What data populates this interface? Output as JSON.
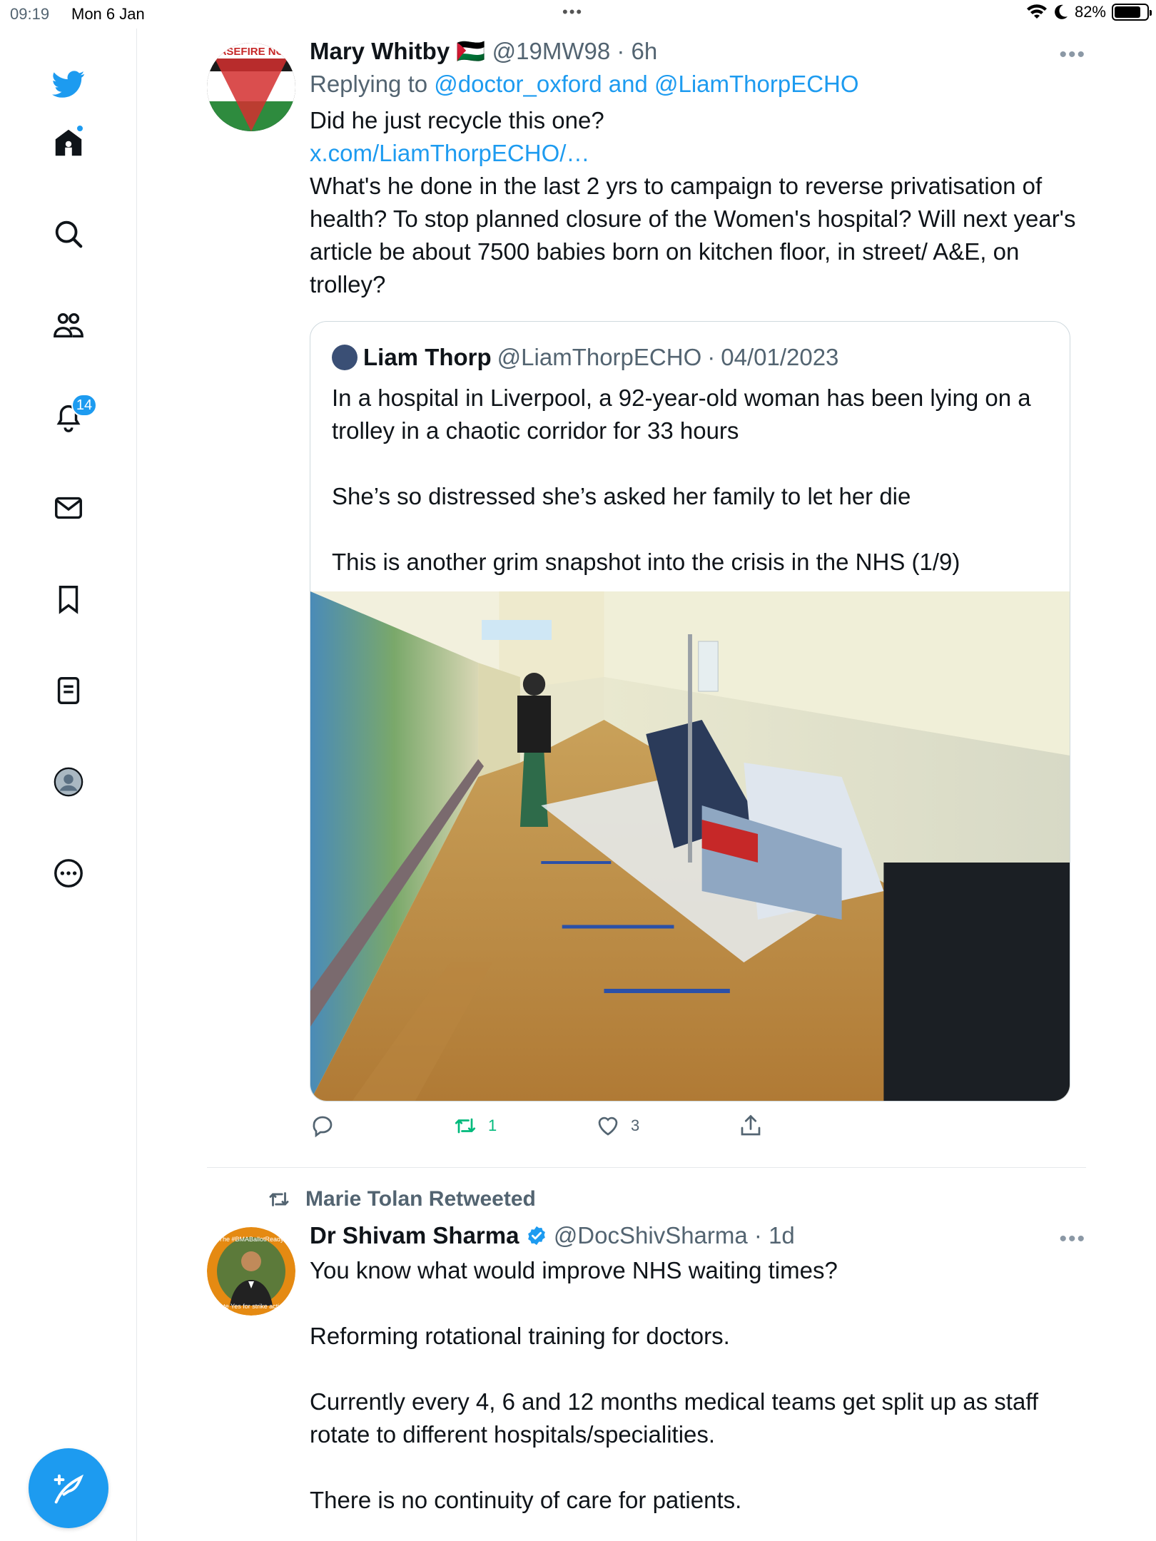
{
  "status_bar": {
    "time": "09:19",
    "date": "Mon 6 Jan",
    "battery": "82%",
    "battery_level": 0.82
  },
  "nav": {
    "notifications_badge": "14",
    "icons": [
      "twitter-logo-icon",
      "home-icon",
      "search-icon",
      "communities-icon",
      "notifications-icon",
      "messages-icon",
      "bookmarks-icon",
      "lists-icon",
      "profile-icon",
      "more-icon"
    ],
    "brand_color": "#1d9bf0"
  },
  "tweet1": {
    "avatar_text": "ASEFIRE NC",
    "name": "Mary Whitby",
    "flag": "🇵🇸",
    "handle": "@19MW98",
    "time": "6h",
    "reply_prefix": "Replying to ",
    "reply_user1": "@doctor_oxford",
    "reply_and": " and ",
    "reply_user2": "@LiamThorpECHO",
    "text_line1": "Did he just recycle this one?",
    "link": "x.com/LiamThorpECHO/…",
    "text_rest": "What's he done in the last 2 yrs to campaign to reverse privatisation of health? To stop planned closure of the Women's hospital? Will next year's article be about 7500 babies born on kitchen floor, in street/ A&E, on trolley?",
    "quote": {
      "name": "Liam Thorp",
      "handle": "@LiamThorpECHO",
      "date": "04/01/2023",
      "text": "In a hospital in Liverpool, a 92-year-old woman has been lying on a trolley in a chaotic corridor for 33 hours\n\nShe’s so distressed she’s asked her family to let her die\n\nThis is another grim snapshot into the crisis in the NHS (1/9)"
    },
    "retweets": "1",
    "likes": "3"
  },
  "retweet_label": "Marie Tolan Retweeted",
  "tweet2": {
    "avatar_top_text": "The #BMABallotReady",
    "avatar_bottom_text": "Vote Yes for strike action",
    "name": "Dr Shivam Sharma",
    "handle": "@DocShivSharma",
    "time": "1d",
    "text": "You know what would improve NHS waiting times?\n\nReforming rotational training for doctors.\n\nCurrently every 4, 6 and 12 months medical teams get split up as staff rotate to different hospitals/specialities.\n\nThere is no continuity of care for patients."
  }
}
